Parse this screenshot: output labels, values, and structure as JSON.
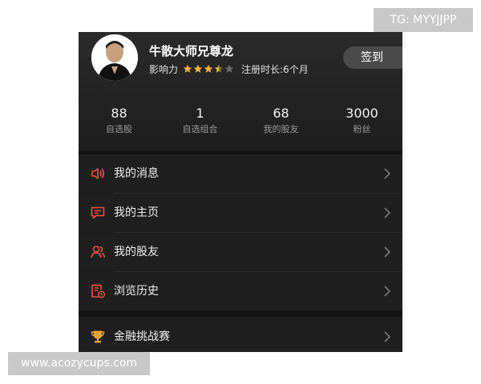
{
  "profile": {
    "username": "牛散大师兄尊龙",
    "influence_label": "影响力",
    "rating": 3.5,
    "rating_max": 5,
    "registration": "注册时长:6个月",
    "checkin_label": "签到"
  },
  "stats": [
    {
      "value": "88",
      "label": "自选股"
    },
    {
      "value": "1",
      "label": "自选组合"
    },
    {
      "value": "68",
      "label": "我的股友"
    },
    {
      "value": "3000",
      "label": "粉丝"
    }
  ],
  "menu": [
    {
      "label": "我的消息",
      "icon": "speaker-icon"
    },
    {
      "label": "我的主页",
      "icon": "chat-bubble-icon"
    },
    {
      "label": "我的股友",
      "icon": "friends-icon"
    },
    {
      "label": "浏览历史",
      "icon": "history-icon"
    }
  ],
  "menu2": [
    {
      "label": "金融挑战赛",
      "icon": "trophy-icon"
    }
  ],
  "watermarks": {
    "top": "TG: MYYJJPP",
    "bottom": "www.acozycups.com"
  },
  "colors": {
    "icon_accent": "#e8533f",
    "trophy": "#e8a43a",
    "background": "#1f1f1f"
  }
}
